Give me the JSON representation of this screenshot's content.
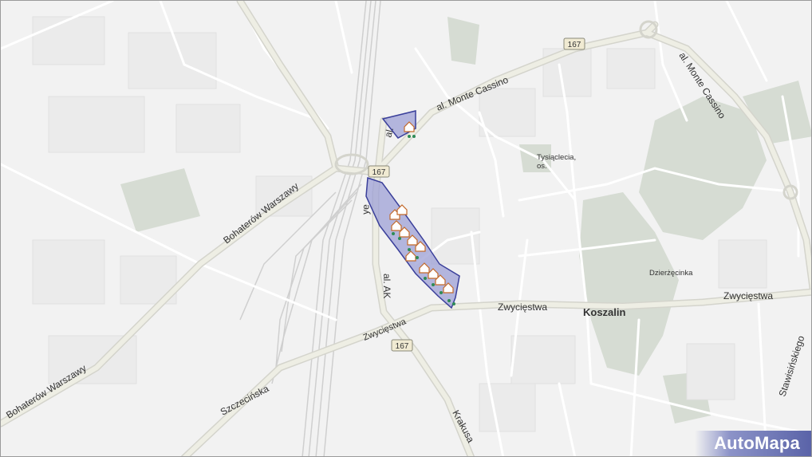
{
  "map": {
    "city": "Koszalin",
    "district": "Dzierżęcinka",
    "estate": "Tysiąclecia, os.",
    "streets": {
      "bohaterow_upper": "Bohaterów Warszawy",
      "bohaterow_lower": "Bohaterów Warszawy",
      "monte_cassino_main": "al. Monte Cassino",
      "monte_cassino_east": "al. Monte Cassino",
      "ak_upper": "al.",
      "ak_mid": "ye",
      "ak_lower": "al. AK",
      "zwyciestwa_west": "Zwycięstwa",
      "zwyciestwa_center": "Zwycięstwa",
      "zwyciestwa_east": "Zwycięstwa",
      "szczecinska": "Szczecińska",
      "krakusa": "Krakusa",
      "stawisinskiego": "Stawisińskiego"
    },
    "route_shields": [
      "167",
      "167",
      "167"
    ],
    "colors": {
      "background": "#f2f2f2",
      "road": "#ffffff",
      "road_casing": "#d8d8d8",
      "main_road": "#e8e8dc",
      "green_area": "#d6dcd3",
      "rail": "#cfcfcf",
      "highlight_fill": "#9da0d6",
      "highlight_stroke": "#3a3f9a",
      "shield_fill": "#f0ead2"
    }
  },
  "brand": {
    "name": "AutoMapa"
  }
}
